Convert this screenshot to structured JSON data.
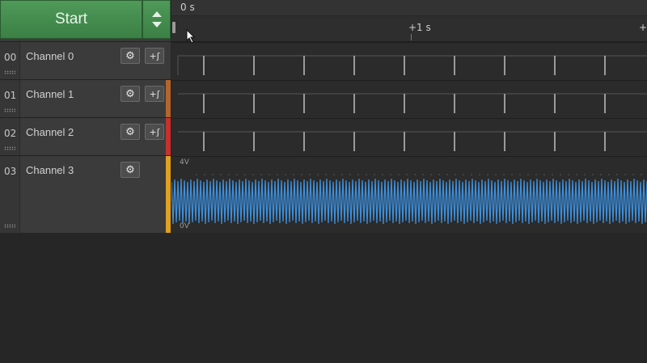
{
  "controls": {
    "start_label": "Start",
    "speed_icon": "up-down-arrows-icon"
  },
  "timeline": {
    "origin_label": "0 s",
    "marker_label": "+1 s",
    "right_edge_label": "+"
  },
  "channels": [
    {
      "number": "00",
      "name": "Channel 0",
      "type": "digital",
      "color": "#3a3a3a",
      "has_trigger": true
    },
    {
      "number": "01",
      "name": "Channel 1",
      "type": "digital",
      "color": "#b5652a",
      "has_trigger": true
    },
    {
      "number": "02",
      "name": "Channel 2",
      "type": "digital",
      "color": "#c9302c",
      "has_trigger": true
    },
    {
      "number": "03",
      "name": "Channel 3",
      "type": "analog",
      "color": "#e0a020",
      "has_trigger": false
    }
  ],
  "analog": {
    "top_label": "4V",
    "bottom_label": "0V",
    "signal_color": "#3c8fdc"
  },
  "icons": {
    "gear": "gear-icon",
    "trigger": "trigger-edge-icon",
    "cursor": "mouse-pointer-icon"
  }
}
